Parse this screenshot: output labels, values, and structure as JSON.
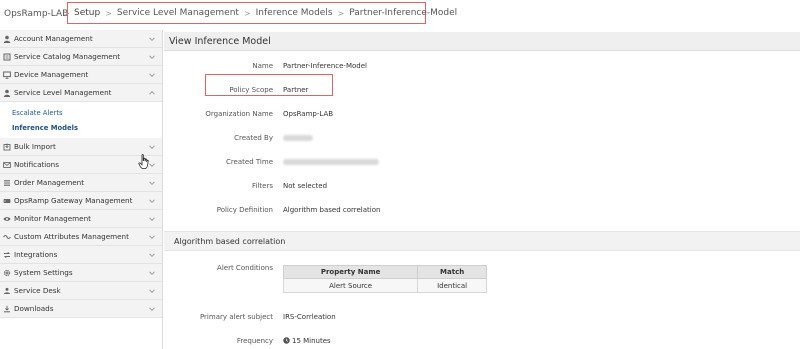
{
  "topbar": {
    "tenant": "OpsRamp-LAB",
    "breadcrumb": [
      "Setup",
      "Service Level Management",
      "Inference Models",
      "Partner-Inference-Model"
    ]
  },
  "sidebar": {
    "items": [
      {
        "label": "Account Management",
        "icon": "user-icon",
        "expanded": false
      },
      {
        "label": "Service Catalog Management",
        "icon": "catalog-icon",
        "expanded": false
      },
      {
        "label": "Device Management",
        "icon": "monitor-icon",
        "expanded": false
      },
      {
        "label": "Service Level Management",
        "icon": "user-icon",
        "expanded": true
      },
      {
        "label": "Bulk Import",
        "icon": "import-icon",
        "expanded": false
      },
      {
        "label": "Notifications",
        "icon": "envelope-icon",
        "expanded": false
      },
      {
        "label": "Order Management",
        "icon": "list-icon",
        "expanded": false
      },
      {
        "label": "OpsRamp Gateway Management",
        "icon": "gateway-icon",
        "expanded": false
      },
      {
        "label": "Monitor Management",
        "icon": "eye-icon",
        "expanded": false
      },
      {
        "label": "Custom Attributes Management",
        "icon": "tags-icon",
        "expanded": false
      },
      {
        "label": "Integrations",
        "icon": "integration-icon",
        "expanded": false
      },
      {
        "label": "System Settings",
        "icon": "gear-icon",
        "expanded": false
      },
      {
        "label": "Service Desk",
        "icon": "service-desk-icon",
        "expanded": false
      },
      {
        "label": "Downloads",
        "icon": "download-icon",
        "expanded": false
      }
    ],
    "sub_items": [
      "Escalate Alerts",
      "Inference Models"
    ],
    "active_sub_item": "Inference Models"
  },
  "main": {
    "title": "View Inference Model",
    "fields": [
      {
        "label": "Name",
        "value": "Partner-Inference-Model"
      },
      {
        "label": "Policy Scope",
        "value": "Partner"
      },
      {
        "label": "Organization Name",
        "value": "OpsRamp-LAB"
      },
      {
        "label": "Created By",
        "value": ""
      },
      {
        "label": "Created Time",
        "value": ""
      },
      {
        "label": "Filters",
        "value": "Not selected"
      },
      {
        "label": "Policy Definition",
        "value": "Algorithm based correlation"
      }
    ],
    "section_title": "Algorithm based correlation",
    "alert_conditions_label": "Alert Conditions",
    "alert_conditions_table": {
      "headers": [
        "Property Name",
        "Match"
      ],
      "rows": [
        [
          "Alert Source",
          "Identical"
        ]
      ]
    },
    "primary_alert_subject_label": "Primary alert subject",
    "primary_alert_subject_value": "IRS-Corrleation",
    "frequency_label": "Frequency",
    "frequency_value": "15 Minutes"
  },
  "colors": {
    "highlight_border": "#e0636a",
    "link": "#1f5a8c"
  }
}
